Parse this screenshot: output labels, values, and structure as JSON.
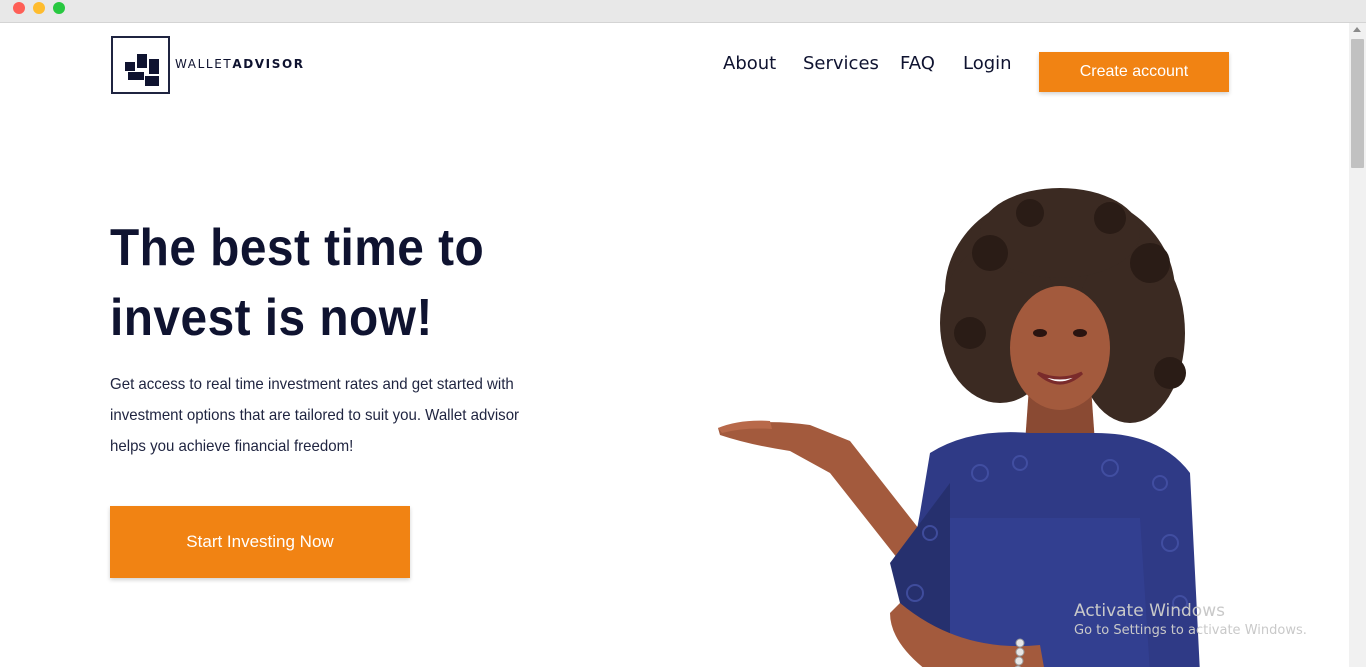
{
  "brand": {
    "name_light": "WALLET",
    "name_bold": "ADVISOR"
  },
  "nav": {
    "items": [
      "About",
      "Services",
      "FAQ",
      "Login"
    ],
    "cta": "Create account"
  },
  "hero": {
    "title_line1": "The best time to",
    "title_line2": "invest is now!",
    "description": "Get access to real time investment rates and get started with investment options that are tailored to suit you. Wallet advisor helps you achieve financial freedom!",
    "cta": "Start Investing Now"
  },
  "watermark": {
    "line1": "Activate Windows",
    "line2": "Go to Settings to activate Windows."
  },
  "colors": {
    "accent": "#f18313",
    "navy": "#0f1330",
    "dress": "#2f3a86"
  },
  "icons": {
    "logo": "wallet-advisor-logo-icon"
  }
}
